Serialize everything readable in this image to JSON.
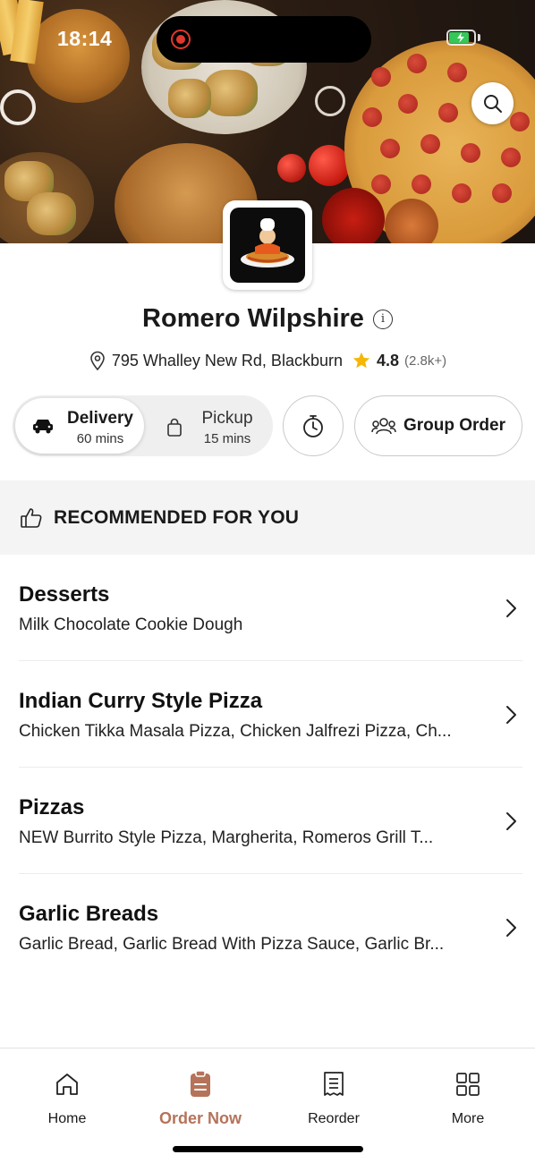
{
  "status_bar": {
    "time": "18:14",
    "battery_level": 0.8,
    "battery_color": "#35c759"
  },
  "hero": {
    "search_icon": "search-icon"
  },
  "restaurant": {
    "name": "Romero Wilpshire",
    "info_icon": "info-icon",
    "address": "795 Whalley New Rd, Blackburn",
    "rating": "4.8",
    "rating_count": "(2.8k+)",
    "star_color": "#f5b60a"
  },
  "order_mode": {
    "delivery": {
      "label": "Delivery",
      "time": "60 mins",
      "selected": true
    },
    "pickup": {
      "label": "Pickup",
      "time": "15 mins",
      "selected": false
    },
    "schedule_icon": "stopwatch-icon",
    "group_order_label": "Group Order"
  },
  "recommended": {
    "title": "RECOMMENDED FOR YOU",
    "categories": [
      {
        "title": "Desserts",
        "items": "Milk Chocolate Cookie Dough"
      },
      {
        "title": "Indian Curry Style Pizza",
        "items": "Chicken Tikka Masala Pizza, Chicken Jalfrezi Pizza, Ch..."
      },
      {
        "title": "Pizzas",
        "items": "NEW Burrito Style Pizza, Margherita, Romeros Grill T..."
      },
      {
        "title": "Garlic Breads",
        "items": "Garlic Bread, Garlic Bread With Pizza Sauce, Garlic Br..."
      }
    ]
  },
  "bottom_nav": {
    "accent_color": "#b5735a",
    "items": [
      {
        "label": "Home",
        "icon": "home-icon"
      },
      {
        "label": "Order Now",
        "icon": "order-clipboard-icon",
        "active": true
      },
      {
        "label": "Reorder",
        "icon": "receipt-icon"
      },
      {
        "label": "More",
        "icon": "grid-icon"
      }
    ]
  }
}
